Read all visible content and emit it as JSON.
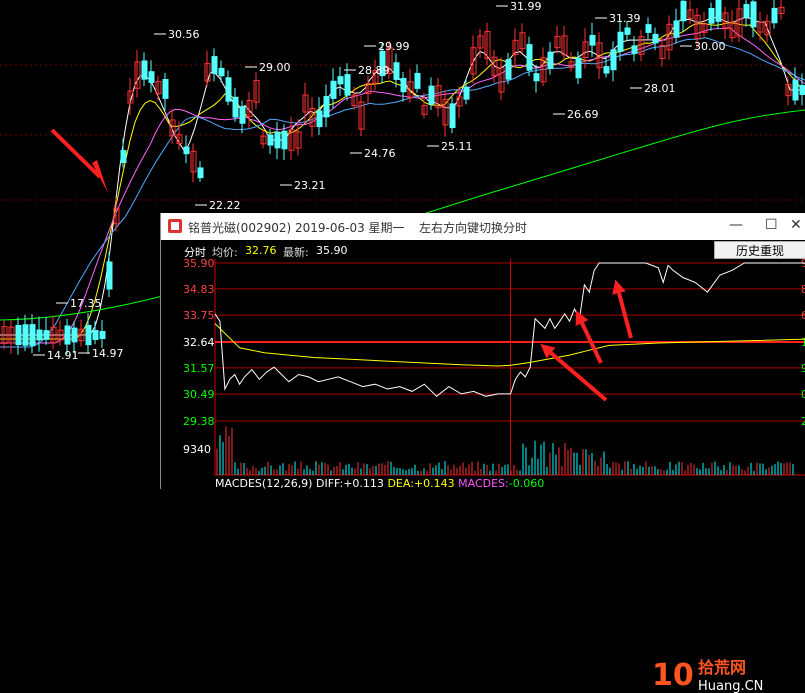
{
  "main_chart": {
    "price_labels": [
      "30.56",
      "29.00",
      "29.99",
      "28.89",
      "31.99",
      "31.39",
      "30.00",
      "28.01",
      "26.69",
      "25.11",
      "24.76",
      "23.21",
      "22.22",
      "17.35",
      "14.91",
      "14.97"
    ],
    "colors": {
      "up": "#ff3232",
      "down": "#54ffff",
      "ma5": "#ffffff",
      "ma10": "#ffff00",
      "ma20": "#ff66ff",
      "ma30": "#00ff00",
      "ma60": "#54aaff"
    }
  },
  "popup": {
    "title": "铭普光磁(002902)   2019-06-03 星期一",
    "hint": "左右方向键切换分时",
    "controls": {
      "minimize": "—",
      "maximize": "☐",
      "close": "✕"
    },
    "info": {
      "mode": "分时",
      "avg_label": "均价:",
      "avg_value": "32.76",
      "last_label": "最新:",
      "last_value": "35.90"
    },
    "history_button": "历史重现",
    "right_axis_fragments": [
      "9",
      "8",
      "6",
      "1",
      "9",
      "0",
      "2",
      "6"
    ],
    "macd": {
      "title": "MACDES(12,26,9)",
      "diff_label": "DIFF:",
      "diff_value": "+0.113",
      "dea_label": "DEA:",
      "dea_value": "+0.143",
      "macd_label": "MACDES:",
      "macd_value": "-0.060"
    },
    "watermark": {
      "number": "10",
      "cn": "拾荒网",
      "url": "Huang.CN"
    }
  },
  "chart_data": {
    "type": "line",
    "title": "",
    "xlabel": "",
    "ylabel": "",
    "ylim": [
      29.38,
      35.9
    ],
    "y_ticks": [
      "35.90",
      "34.83",
      "33.75",
      "32.64",
      "31.57",
      "30.49",
      "29.38"
    ],
    "volume_tick": "9340",
    "x_range_minutes": [
      0,
      240
    ],
    "series": [
      {
        "name": "最新",
        "x": [
          0,
          2,
          4,
          6,
          8,
          10,
          12,
          15,
          18,
          21,
          24,
          27,
          30,
          34,
          38,
          42,
          46,
          50,
          55,
          60,
          65,
          70,
          75,
          80,
          85,
          90,
          95,
          100,
          105,
          110,
          115,
          120,
          122,
          124,
          126,
          128,
          130,
          132,
          134,
          136,
          138,
          140,
          142,
          144,
          146,
          148,
          150,
          152,
          154,
          156,
          158,
          160,
          162,
          166,
          170,
          175,
          180,
          182,
          184,
          186,
          190,
          195,
          200,
          205,
          210,
          215,
          220,
          225,
          230,
          235,
          240
        ],
        "y": [
          33.8,
          33.5,
          30.7,
          31.1,
          31.3,
          30.9,
          31.2,
          31.5,
          31.1,
          31.4,
          31.6,
          31.3,
          31.0,
          31.3,
          31.2,
          31.0,
          31.1,
          31.2,
          31.0,
          30.8,
          30.9,
          30.7,
          30.8,
          30.6,
          30.9,
          30.4,
          30.8,
          30.5,
          30.6,
          30.4,
          30.5,
          30.5,
          31.1,
          31.4,
          31.2,
          31.6,
          33.6,
          33.4,
          33.2,
          33.6,
          33.2,
          33.5,
          33.8,
          33.5,
          34.0,
          33.6,
          35.0,
          34.7,
          35.6,
          35.9,
          35.9,
          35.9,
          35.9,
          35.9,
          35.9,
          35.9,
          35.7,
          35.1,
          35.8,
          35.6,
          35.3,
          35.1,
          34.7,
          35.4,
          35.6,
          35.9,
          35.9,
          35.9,
          35.9,
          35.9,
          35.9
        ]
      },
      {
        "name": "均价",
        "x": [
          0,
          10,
          20,
          40,
          60,
          80,
          100,
          115,
          120,
          128,
          136,
          144,
          152,
          160,
          180,
          200,
          220,
          240
        ],
        "y": [
          33.4,
          32.4,
          32.2,
          32.0,
          31.9,
          31.8,
          31.7,
          31.65,
          31.68,
          31.8,
          31.95,
          32.1,
          32.3,
          32.5,
          32.6,
          32.65,
          32.7,
          32.76
        ]
      }
    ],
    "reference_line": 32.64
  }
}
